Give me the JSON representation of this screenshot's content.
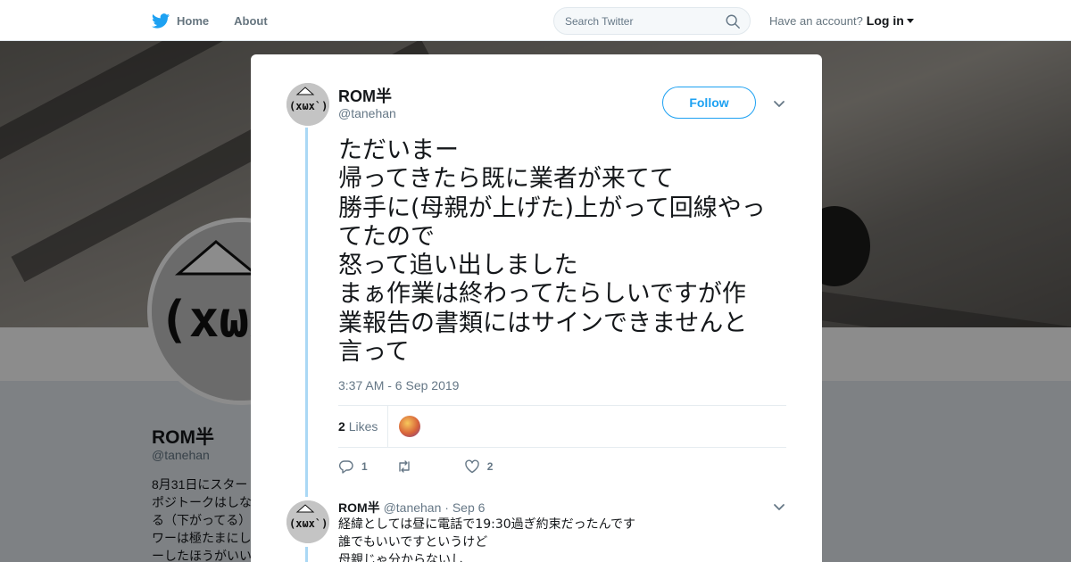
{
  "nav": {
    "home_label": "Home",
    "about_label": "About",
    "search_placeholder": "Search Twitter",
    "account_prompt": "Have an account?",
    "login_label": "Log in"
  },
  "background_profile": {
    "name": "ROM半",
    "handle": "@tanehan",
    "bio": "8月31日にスター\nポジトークはしな\nる（下がってる）\nワーは極たまにし\nーしたほうがいい"
  },
  "avatar_text": "(xωx`)",
  "tweet": {
    "author_name": "ROM半",
    "author_handle": "@tanehan",
    "follow_label": "Follow",
    "text": "ただいまー\n帰ってきたら既に業者が来てて\n勝手に(母親が上げた)上がって回線やっ\nてたので\n怒って追い出しました\nまぁ作業は終わってたらしいですが作\n業報告の書類にはサインできませんと\n言って",
    "timestamp": "3:37 AM - 6 Sep 2019",
    "likes_count": "2",
    "likes_label": "Likes",
    "replies": "1",
    "retweets": "",
    "likes": "2"
  },
  "reply": {
    "author_name": "ROM半",
    "author_handle": "@tanehan",
    "date": "· Sep 6",
    "text": "経緯としては昼に電話で19:30過ぎ約束だったんです\n誰でもいいですというけど\n母親じゃ分からないし"
  },
  "colors": {
    "accent": "#1da1f2",
    "thread_line": "#aad8f5",
    "muted": "#657786"
  }
}
